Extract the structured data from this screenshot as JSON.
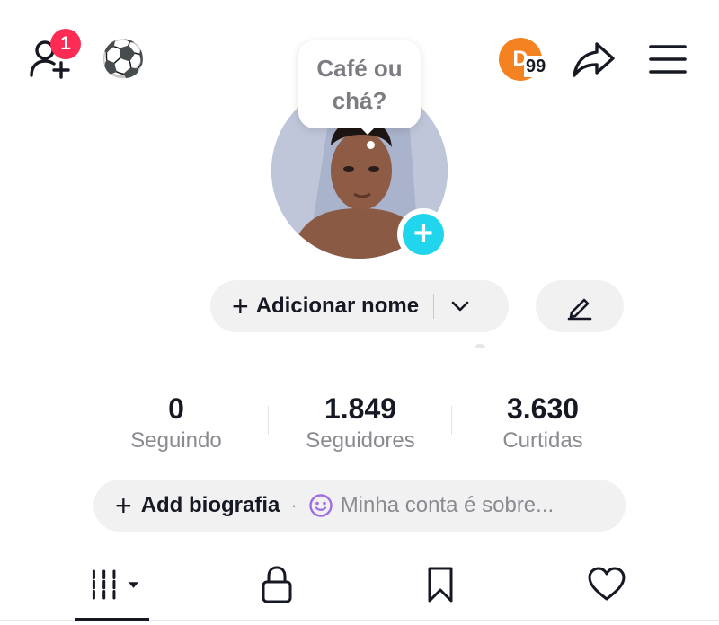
{
  "header": {
    "notification_count": "1",
    "friends_icon": "add-friend-icon",
    "emoji": "⚽",
    "streak": {
      "initial": "D",
      "count": "99",
      "color": "#f58220"
    },
    "share_icon": "share-arrow-icon",
    "menu_icon": "hamburger-menu-icon"
  },
  "avatar": {
    "speech_bubble": "Café ou chá?",
    "add_icon": "plus-icon",
    "add_color": "#20d5ec"
  },
  "profile": {
    "add_name_plus": "+",
    "add_name_label": "Adicionar nome",
    "dropdown_icon": "chevron-down-icon",
    "edit_icon": "pencil-icon"
  },
  "stats": [
    {
      "value": "0",
      "label": "Seguindo"
    },
    {
      "value": "1.849",
      "label": "Seguidores"
    },
    {
      "value": "3.630",
      "label": "Curtidas"
    }
  ],
  "bio": {
    "plus": "+",
    "label": "Add biografia",
    "separator": "·",
    "emoji_icon": "smiley-icon",
    "placeholder": "Minha conta é sobre..."
  },
  "tabs": [
    {
      "name": "videos",
      "icon": "grid-icon",
      "selected": true
    },
    {
      "name": "private",
      "icon": "lock-icon",
      "selected": false
    },
    {
      "name": "saved",
      "icon": "bookmark-icon",
      "selected": false
    },
    {
      "name": "liked",
      "icon": "heart-icon",
      "selected": false
    }
  ],
  "colors": {
    "badge": "#fe2c55",
    "text": "#161823",
    "secondary_text": "#8a8b91",
    "pill_bg": "#f1f1f2"
  }
}
